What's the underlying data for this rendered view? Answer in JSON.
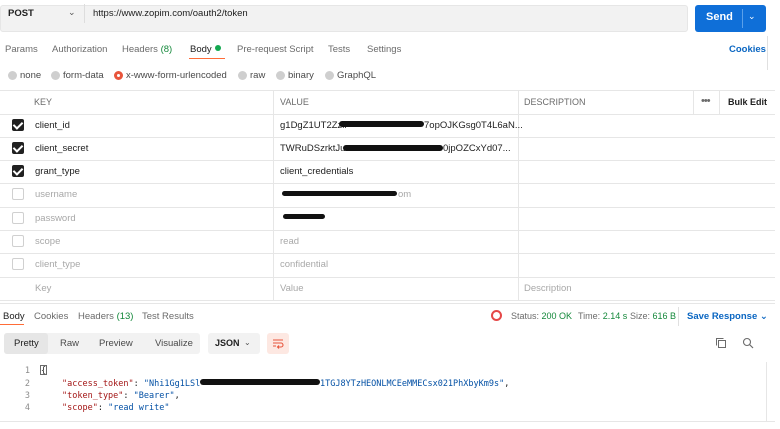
{
  "request": {
    "method": "POST",
    "url": "https://www.zopim.com/oauth2/token",
    "send_label": "Send"
  },
  "request_tabs": {
    "params": "Params",
    "authorization": "Authorization",
    "headers": "Headers",
    "headers_count": "(8)",
    "body": "Body",
    "pre_request": "Pre-request Script",
    "tests": "Tests",
    "settings": "Settings",
    "cookies": "Cookies"
  },
  "body_types": {
    "none": "none",
    "form_data": "form-data",
    "urlencoded": "x-www-form-urlencoded",
    "raw": "raw",
    "binary": "binary",
    "graphql": "GraphQL",
    "selected": "x-www-form-urlencoded"
  },
  "table": {
    "headers": {
      "key": "KEY",
      "value": "VALUE",
      "description": "DESCRIPTION",
      "more": "•••",
      "bulk_edit": "Bulk Edit"
    },
    "rows": [
      {
        "checked": true,
        "key": "client_id",
        "value_start": "g1DgZ1UT2Zzll",
        "value_end": "7opOJKGsg0T4L6aN..."
      },
      {
        "checked": true,
        "key": "client_secret",
        "value_start": "TWRuDSzrktJu",
        "value_end": "0jpOZCxYd07..."
      },
      {
        "checked": true,
        "key": "grant_type",
        "value": "client_credentials"
      },
      {
        "checked": false,
        "key": "username",
        "value_end": "om"
      },
      {
        "checked": false,
        "key": "password",
        "value": ""
      },
      {
        "checked": false,
        "key": "scope",
        "value": "read"
      },
      {
        "checked": false,
        "key": "client_type",
        "value": "confidential"
      }
    ],
    "placeholder": {
      "key": "Key",
      "value": "Value",
      "description": "Description"
    }
  },
  "response_tabs": {
    "body": "Body",
    "cookies": "Cookies",
    "headers": "Headers",
    "headers_count": "(13)",
    "test_results": "Test Results"
  },
  "response_status": {
    "status_label": "Status:",
    "status_value": "200 OK",
    "time_label": "Time:",
    "time_value": "2.14 s",
    "size_label": "Size:",
    "size_value": "616 B",
    "save_response": "Save Response"
  },
  "format": {
    "pretty": "Pretty",
    "raw": "Raw",
    "preview": "Preview",
    "visualize": "Visualize",
    "language": "JSON"
  },
  "code": {
    "line_numbers": [
      "1",
      "2",
      "3",
      "4"
    ],
    "open_brace": "{",
    "access_token_key": "\"access_token\"",
    "access_token_prefix": "\"Nhi1Gg1LSl",
    "access_token_suffix": "1TGJ8YTzHEONLMCEeMMECsx021PhXbyKm9s\"",
    "token_type_key": "\"token_type\"",
    "token_type_value": "\"Bearer\"",
    "scope_key": "\"scope\"",
    "scope_value": "\"read write\"",
    "colon": ": ",
    "comma": ","
  },
  "colors": {
    "send_button": "#0f6fd8",
    "accent": "#ff6c37",
    "status_ok": "#13883a",
    "link": "#0a66c2"
  }
}
